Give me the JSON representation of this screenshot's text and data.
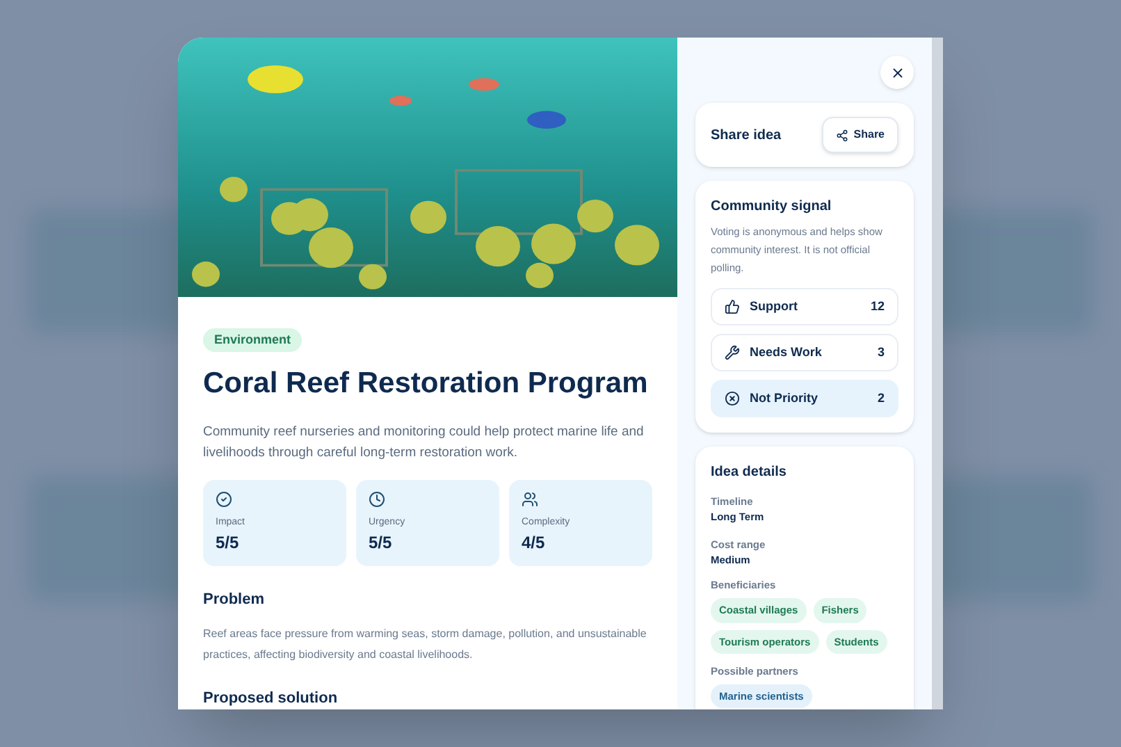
{
  "idea": {
    "category": "Environment",
    "title": "Coral Reef Restoration Program",
    "summary": "Community reef nurseries and monitoring could help protect marine life and livelihoods through careful long-term restoration work.",
    "metrics": [
      {
        "kind": "impact",
        "label": "Impact",
        "value": "5/5"
      },
      {
        "kind": "urgency",
        "label": "Urgency",
        "value": "5/5"
      },
      {
        "kind": "complexity",
        "label": "Complexity",
        "value": "4/5"
      }
    ],
    "sections": [
      {
        "heading": "Problem",
        "text": "Reef areas face pressure from warming seas, storm damage, pollution, and unsustainable practices, affecting biodiversity and coastal livelihoods."
      },
      {
        "heading": "Proposed solution"
      }
    ]
  },
  "share": {
    "title": "Share idea",
    "button": "Share"
  },
  "signal": {
    "title": "Community signal",
    "note": "Voting is anonymous and helps show community interest. It is not official polling.",
    "votes": [
      {
        "kind": "support",
        "label": "Support",
        "count": "12",
        "selected": false
      },
      {
        "kind": "needs_work",
        "label": "Needs Work",
        "count": "3",
        "selected": false
      },
      {
        "kind": "not_priority",
        "label": "Not Priority",
        "count": "2",
        "selected": true
      }
    ]
  },
  "details": {
    "title": "Idea details",
    "fields": [
      {
        "label": "Timeline",
        "value": "Long Term"
      },
      {
        "label": "Cost range",
        "value": "Medium"
      }
    ],
    "groups": [
      {
        "kind": "beneficiaries",
        "label": "Beneficiaries",
        "tags": [
          "Coastal villages",
          "Fishers",
          "Tourism operators",
          "Students"
        ]
      },
      {
        "kind": "partners",
        "label": "Possible partners",
        "tags": [
          "Marine scientists"
        ]
      }
    ]
  }
}
